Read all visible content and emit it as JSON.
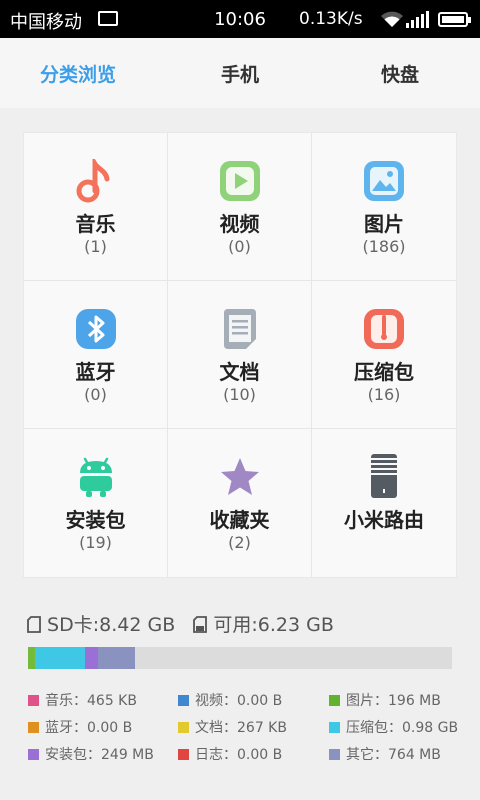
{
  "status_bar": {
    "carrier": "中国移动",
    "time": "10:06",
    "speed": "0.13K/s",
    "icons": [
      "image-icon",
      "wifi-icon",
      "signal-icon",
      "battery-icon"
    ]
  },
  "tabs": [
    {
      "label": "分类浏览",
      "active": true
    },
    {
      "label": "手机",
      "active": false
    },
    {
      "label": "快盘",
      "active": false
    }
  ],
  "categories": [
    {
      "label": "音乐",
      "count": "(1)",
      "icon": "music-note-icon",
      "color": "#f4725a"
    },
    {
      "label": "视频",
      "count": "(0)",
      "icon": "video-play-icon",
      "color": "#8fd27a"
    },
    {
      "label": "图片",
      "count": "(186)",
      "icon": "picture-icon",
      "color": "#5eb4ec"
    },
    {
      "label": "蓝牙",
      "count": "(0)",
      "icon": "bluetooth-icon",
      "color": "#4ea4e8"
    },
    {
      "label": "文档",
      "count": "(10)",
      "icon": "document-icon",
      "color": "#a5adb6"
    },
    {
      "label": "压缩包",
      "count": "(16)",
      "icon": "archive-icon",
      "color": "#f06a57"
    },
    {
      "label": "安装包",
      "count": "(19)",
      "icon": "android-icon",
      "color": "#2ecc9c"
    },
    {
      "label": "收藏夹",
      "count": "(2)",
      "icon": "star-icon",
      "color": "#a088c4"
    },
    {
      "label": "小米路由",
      "count": "",
      "icon": "router-icon",
      "color": "#555b63"
    }
  ],
  "storage": {
    "sd_label": "SD卡:8.42 GB",
    "available_label": "可用:6.23 GB",
    "used_fraction_segments": [
      {
        "name": "音乐",
        "fraction": 0.0,
        "color": "#e0528a"
      },
      {
        "name": "图片",
        "fraction": 0.017,
        "color": "#75bb3b"
      },
      {
        "name": "压缩包",
        "fraction": 0.118,
        "color": "#3fc8e6"
      },
      {
        "name": "安装包",
        "fraction": 0.029,
        "color": "#9a70d6"
      },
      {
        "name": "其它",
        "fraction": 0.089,
        "color": "#8a93bf"
      }
    ]
  },
  "legend": [
    {
      "text": "音乐：465 KB",
      "color": "#e0528a"
    },
    {
      "text": "视频：0.00 B",
      "color": "#3f88cf"
    },
    {
      "text": "图片：196 MB",
      "color": "#62b22f"
    },
    {
      "text": "蓝牙：0.00 B",
      "color": "#e0901f"
    },
    {
      "text": "文档：267 KB",
      "color": "#e3c92d"
    },
    {
      "text": "压缩包：0.98 GB",
      "color": "#3fc8e6"
    },
    {
      "text": "安装包：249 MB",
      "color": "#9a70d6"
    },
    {
      "text": "日志：0.00 B",
      "color": "#e0463f"
    },
    {
      "text": "其它：764 MB",
      "color": "#8a93bf"
    }
  ]
}
